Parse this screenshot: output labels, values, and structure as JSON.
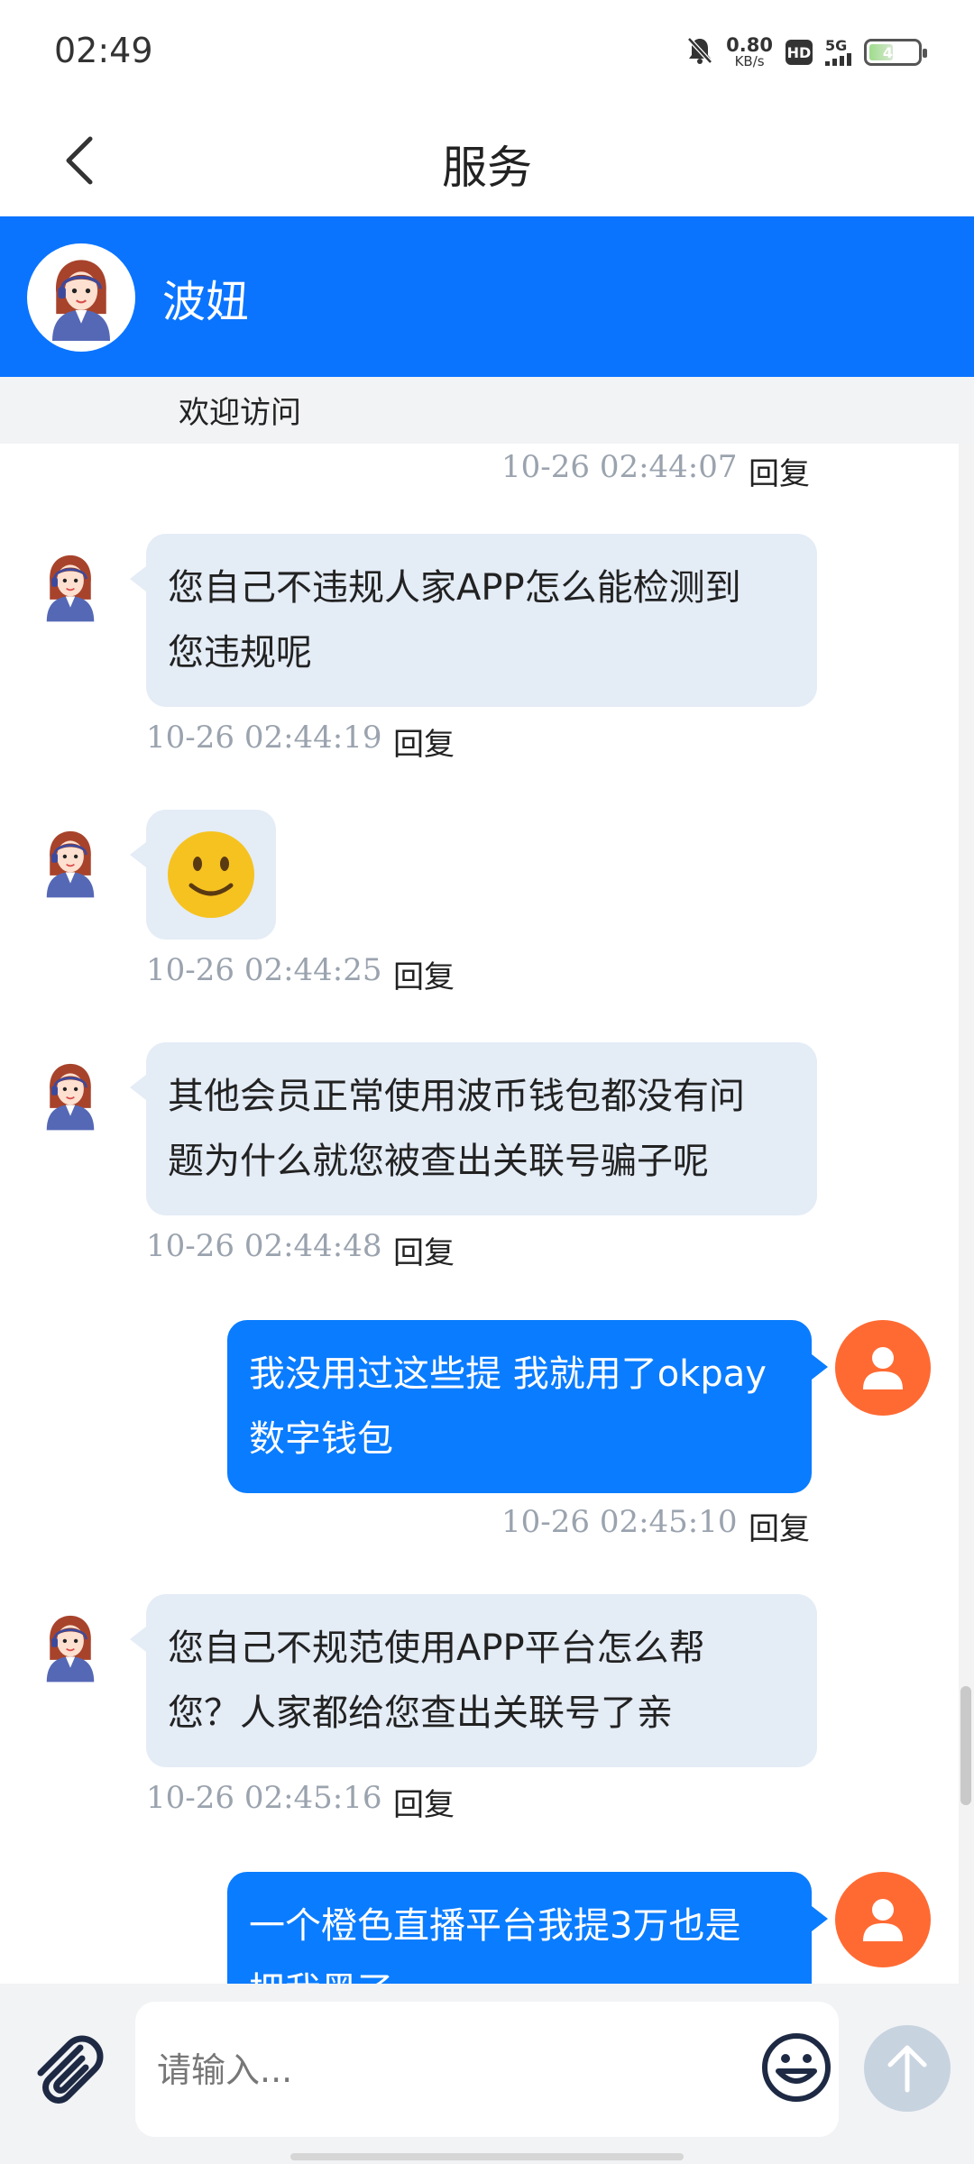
{
  "status_bar": {
    "time": "02:49",
    "net_speed_value": "0.80",
    "net_speed_unit": "KB/s",
    "hd_label": "HD",
    "network_label": "5G",
    "battery_level": "44",
    "icons": [
      "mute-bell-icon",
      "hd-icon",
      "signal-icon",
      "battery-icon"
    ]
  },
  "nav": {
    "title": "服务",
    "back_icon": "chevron-left-icon"
  },
  "agent": {
    "name": "波妞",
    "welcome": "欢迎访问"
  },
  "messages": [
    {
      "side": "out",
      "time": "10-26 02:44:07",
      "reply": "回复"
    },
    {
      "side": "in",
      "lines": [
        "您自己不违规人家APP怎么能检测到",
        "您违规呢"
      ],
      "time": "10-26 02:44:19",
      "reply": "回复"
    },
    {
      "side": "in",
      "emoji": "slightly-smiling-face",
      "time": "10-26 02:44:25",
      "reply": "回复"
    },
    {
      "side": "in",
      "lines": [
        "其他会员正常使用波币钱包都没有问",
        "题为什么就您被查出关联号骗子呢"
      ],
      "time": "10-26 02:44:48",
      "reply": "回复"
    },
    {
      "side": "out",
      "lines": [
        "我没用过这些提 我就用了okpay",
        "数字钱包"
      ],
      "time": "10-26 02:45:10",
      "reply": "回复"
    },
    {
      "side": "in",
      "lines": [
        "您自己不规范使用APP平台怎么帮",
        "您？人家都给您查出关联号了亲"
      ],
      "time": "10-26 02:45:16",
      "reply": "回复"
    },
    {
      "side": "out",
      "lines": [
        "一个橙色直播平台我提3万也是",
        "把我黑了"
      ]
    }
  ],
  "input": {
    "placeholder": "请输入..."
  },
  "colors": {
    "brand_blue": "#0a74ff",
    "incoming_bubble": "#e4ecf6",
    "outgoing_bubble": "#0a7cff",
    "user_avatar": "#ff6a33",
    "timestamp": "#9aa3ae"
  }
}
